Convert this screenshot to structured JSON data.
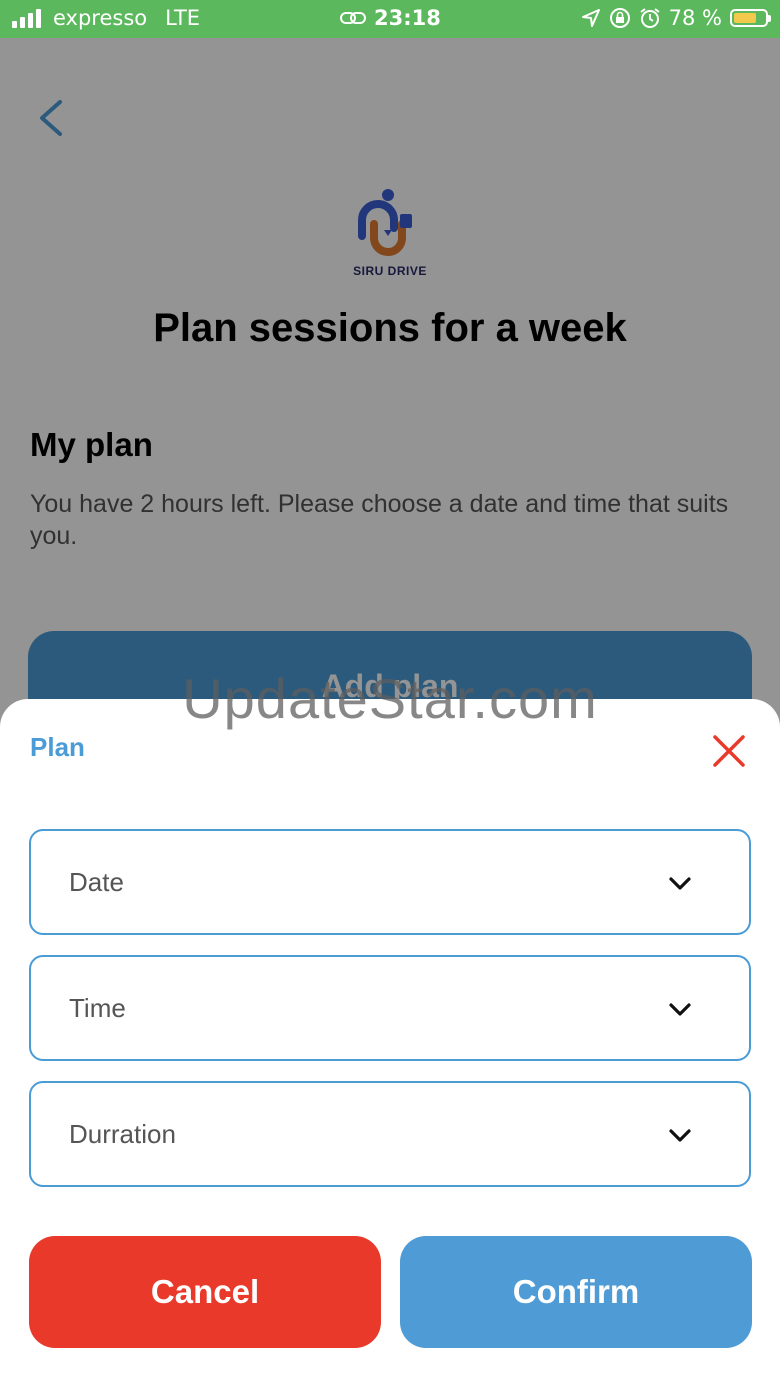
{
  "status_bar": {
    "carrier": "expresso",
    "network": "LTE",
    "time": "23:18",
    "battery_percent": "78 %",
    "battery_level": 0.78,
    "icons": [
      "signal-icon",
      "link-icon",
      "location-icon",
      "orientation-lock-icon",
      "alarm-icon",
      "battery-icon"
    ]
  },
  "header": {
    "back_icon": "chevron-left-icon",
    "logo_text": "SIRU DRIVE",
    "title": "Plan sessions for a week"
  },
  "my_plan": {
    "title": "My plan",
    "description": "You have 2 hours left. Please choose a date and time that suits you."
  },
  "add_plan_label": "Add plan",
  "sheet": {
    "title": "Plan",
    "close_icon": "close-icon",
    "fields": [
      {
        "label": "Date"
      },
      {
        "label": "Time"
      },
      {
        "label": "Durration"
      }
    ],
    "cancel_label": "Cancel",
    "confirm_label": "Confirm"
  },
  "watermark": "UpdateStar.com",
  "colors": {
    "status_bar": "#5cb85c",
    "accent_blue": "#4a9bd6",
    "cancel_red": "#e8392a",
    "close_red": "#e8392a"
  }
}
